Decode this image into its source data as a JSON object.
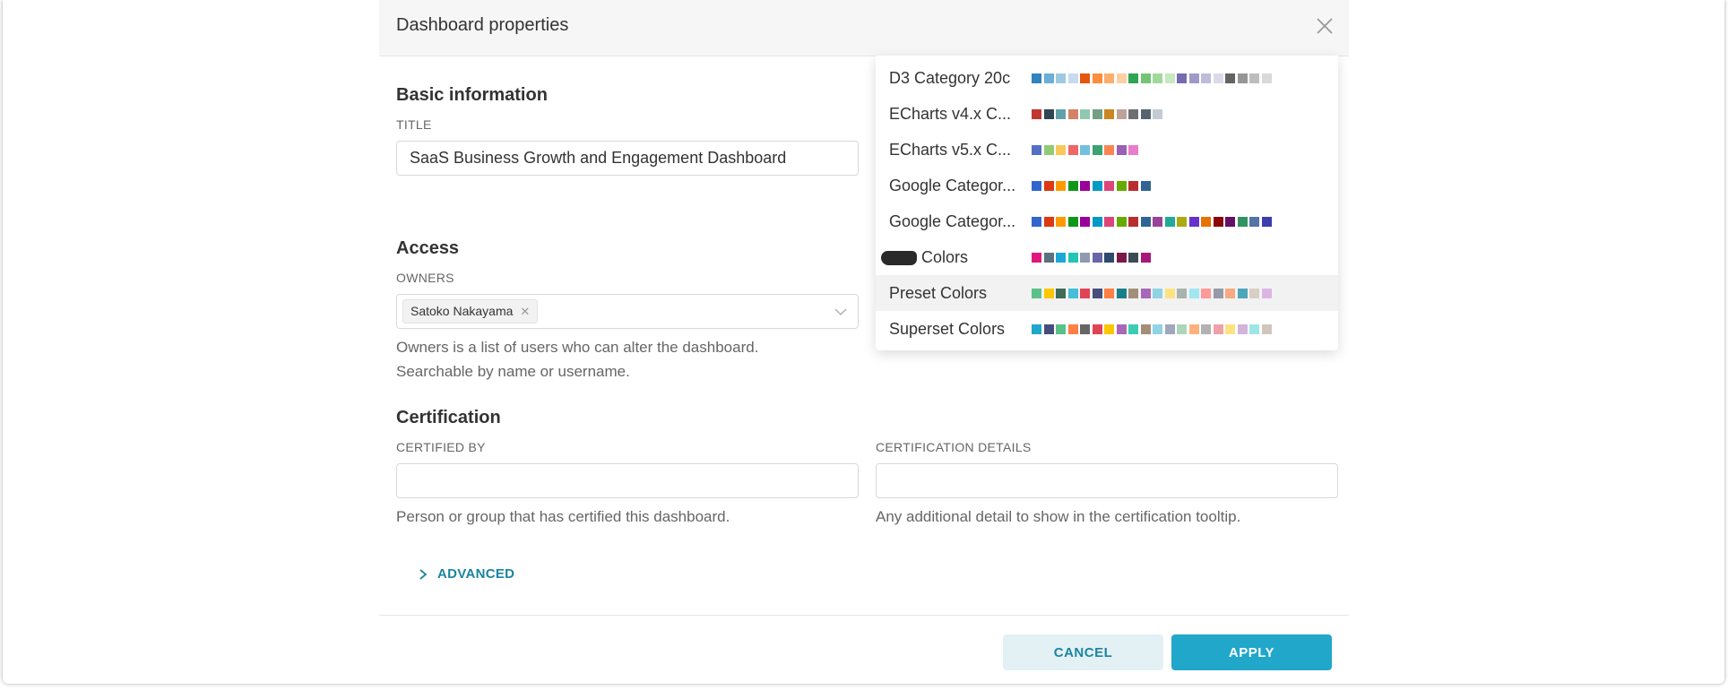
{
  "modal": {
    "title": "Dashboard properties"
  },
  "basic": {
    "section_title": "Basic information",
    "title_label": "TITLE",
    "title_value": "SaaS Business Growth and Engagement Dashboard"
  },
  "access": {
    "section_title": "Access",
    "owners_label": "OWNERS",
    "owners": [
      "Satoko Nakayama"
    ],
    "owners_help_line1": "Owners is a list of users who can alter the dashboard.",
    "owners_help_line2": "Searchable by name or username."
  },
  "certification": {
    "section_title": "Certification",
    "certified_by_label": "CERTIFIED BY",
    "certified_by_value": "",
    "certified_by_help": "Person or group that has certified this dashboard.",
    "details_label": "CERTIFICATION DETAILS",
    "details_value": "",
    "details_help": "Any additional detail to show in the certification tooltip."
  },
  "advanced_label": "ADVANCED",
  "buttons": {
    "cancel": "CANCEL",
    "apply": "APPLY"
  },
  "icons": {
    "close": "close-icon",
    "chevron_down": "chevron-down-icon",
    "chevron_right": "chevron-right-icon"
  },
  "colors": {
    "accent": "#20a7c9",
    "accent_dark": "#1a85a0",
    "cancel_bg": "#e3f1f5"
  },
  "color_palettes": [
    {
      "name": "D3 Category 20c",
      "colors": [
        "#3182bd",
        "#6baed6",
        "#9ecae1",
        "#c6dbef",
        "#e6550d",
        "#fd8d3c",
        "#fdae6b",
        "#fdd0a2",
        "#31a354",
        "#74c476",
        "#a1d99b",
        "#c7e9c0",
        "#756bb1",
        "#9e9ac8",
        "#bcbddc",
        "#dadaeb",
        "#636363",
        "#969696",
        "#bdbdbd",
        "#d9d9d9"
      ]
    },
    {
      "name": "ECharts v4.x C...",
      "colors": [
        "#c23531",
        "#2f4554",
        "#61a0a8",
        "#d48265",
        "#91c7ae",
        "#749f83",
        "#ca8622",
        "#bda29a",
        "#6e7074",
        "#546570",
        "#c4ccd3"
      ]
    },
    {
      "name": "ECharts v5.x C...",
      "colors": [
        "#5470c6",
        "#91cc75",
        "#fac858",
        "#ee6666",
        "#73c0de",
        "#3ba272",
        "#fc8452",
        "#9a60b4",
        "#ea7ccc"
      ]
    },
    {
      "name": "Google Categor...",
      "colors": [
        "#3366cc",
        "#dc3912",
        "#ff9900",
        "#109618",
        "#990099",
        "#0099c6",
        "#dd4477",
        "#66aa00",
        "#b82e2e",
        "#316395"
      ]
    },
    {
      "name": "Google Categor...",
      "colors": [
        "#3366cc",
        "#dc3912",
        "#ff9900",
        "#109618",
        "#990099",
        "#0099c6",
        "#dd4477",
        "#66aa00",
        "#b82e2e",
        "#316395",
        "#994499",
        "#22aa99",
        "#aaaa11",
        "#6633cc",
        "#e67300",
        "#8b0707",
        "#651067",
        "#329262",
        "#5574a6",
        "#3b3eac"
      ]
    },
    {
      "name": "Colors",
      "colors": [
        "#e0177f",
        "#5a7080",
        "#1ba8d6",
        "#21c5b6",
        "#8e9aaf",
        "#6a64a8",
        "#2e4a6e",
        "#7a1848",
        "#3c4a56",
        "#a8187a"
      ],
      "redacted_prefix": true
    },
    {
      "name": "Preset Colors",
      "colors": [
        "#5ac189",
        "#fcc700",
        "#3f6b57",
        "#45bed6",
        "#e04355",
        "#454e7c",
        "#ff7f44",
        "#1a7f8a",
        "#a38f79",
        "#a868b7",
        "#8fd3e4",
        "#fde380",
        "#a8b3ae",
        "#a0e6f3",
        "#ff9999",
        "#959ba8",
        "#f7a982",
        "#4ea6b9",
        "#d8cfc4",
        "#dcb6e3"
      ],
      "active": true
    },
    {
      "name": "Superset Colors",
      "colors": [
        "#1fa8c9",
        "#454e7c",
        "#5ac189",
        "#ff7f44",
        "#666666",
        "#e04355",
        "#fcc700",
        "#a868b7",
        "#3cccb4",
        "#a38f79",
        "#8fd3e4",
        "#a1a6bd",
        "#acd6b9",
        "#feb17c",
        "#b2b2b2",
        "#efa1aa",
        "#fde380",
        "#d3b3da",
        "#9ee5e5",
        "#d1c6bc"
      ]
    }
  ]
}
